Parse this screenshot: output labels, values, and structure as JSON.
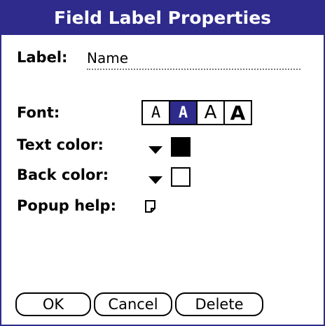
{
  "dialog": {
    "title": "Field Label Properties"
  },
  "label_row": {
    "label": "Label:",
    "value": "Name"
  },
  "font_row": {
    "label": "Font:",
    "options": [
      "A",
      "A",
      "A",
      "A"
    ],
    "selected_index": 1
  },
  "text_color_row": {
    "label": "Text color:",
    "swatch_color": "#000000"
  },
  "back_color_row": {
    "label": "Back color:",
    "swatch_color": "#ffffff"
  },
  "popup_help_row": {
    "label": "Popup help:",
    "icon": "note-icon"
  },
  "buttons": {
    "ok": "OK",
    "cancel": "Cancel",
    "delete": "Delete"
  },
  "colors": {
    "accent": "#2e2b8c"
  }
}
